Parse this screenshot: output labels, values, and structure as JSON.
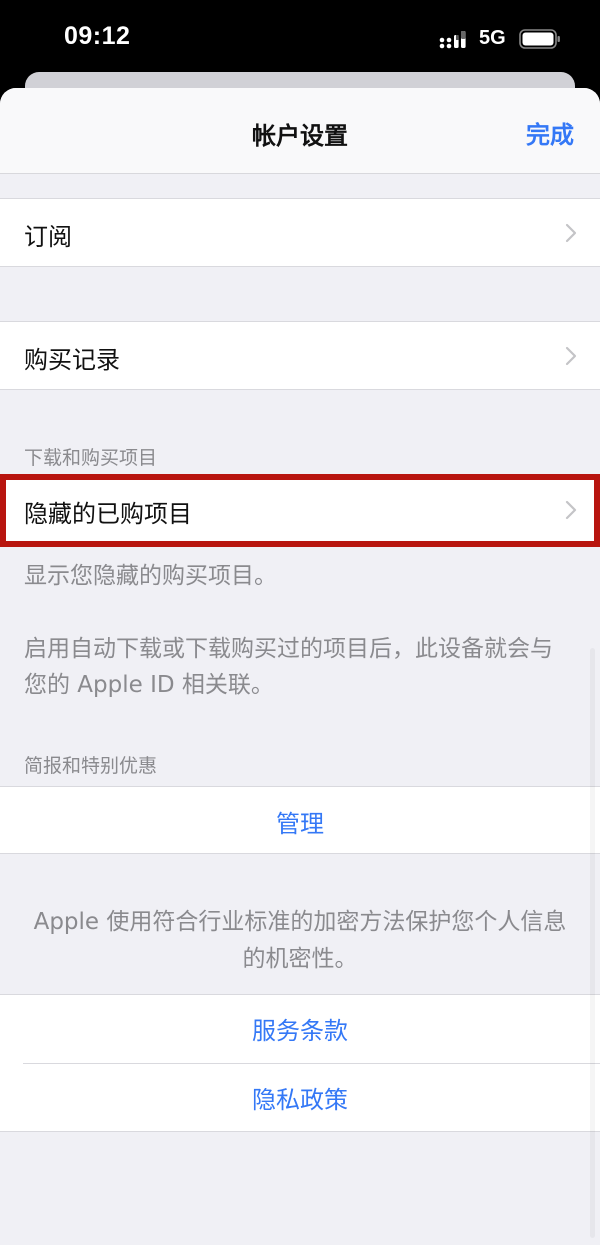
{
  "status_bar": {
    "time": "09:12",
    "network": "5G",
    "signal_icon": "cellular-signal-icon",
    "battery_icon": "battery-icon"
  },
  "nav": {
    "title": "帐户设置",
    "done_label": "完成"
  },
  "rows": {
    "subscriptions": "订阅",
    "purchase_history": "购买记录",
    "hidden_purchases": "隐藏的已购项目"
  },
  "sections": {
    "downloads_header": "下载和购买项目",
    "hidden_footer": "显示您隐藏的购买项目。",
    "auto_download_note": "启用自动下载或下载购买过的项目后，此设备就会与您的 Apple ID 相关联。",
    "newsletters_header": "简报和特别优惠",
    "manage_label": "管理",
    "privacy_note": "Apple 使用符合行业标准的加密方法保护您个人信息的机密性。",
    "terms_label": "服务条款",
    "privacy_label": "隐私政策"
  },
  "colors": {
    "accent": "#3478f6",
    "highlight_border": "#b8150f",
    "grouped_background": "#f0f0f5",
    "secondary_text": "#8a8a8e"
  }
}
